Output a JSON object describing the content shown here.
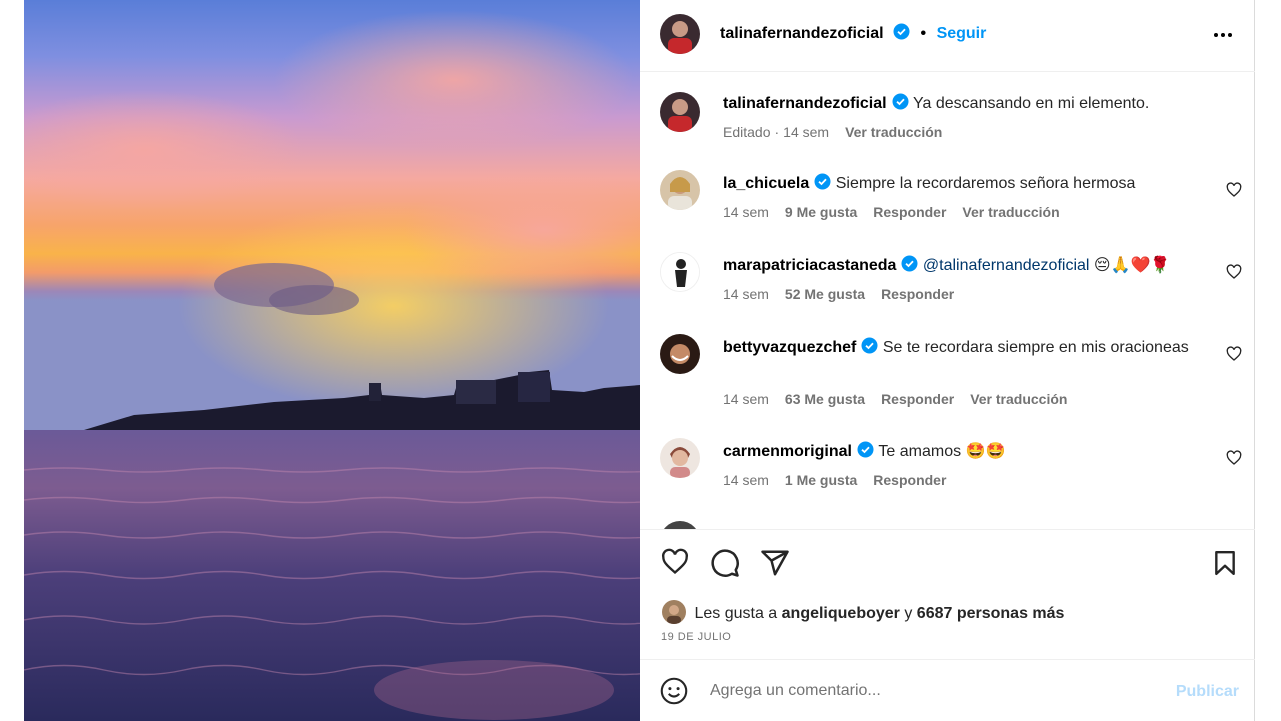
{
  "post": {
    "author": "talinafernandezoficial",
    "follow_label": "Seguir",
    "more_icon": "more-options-icon"
  },
  "caption": {
    "username": "talinafernandezoficial",
    "text": "Ya descansando en mi elemento.",
    "edited": "Editado",
    "time": "14 sem",
    "translate": "Ver traducción"
  },
  "comments": [
    {
      "username": "la_chicuela",
      "text": "Siempre la recordaremos señora hermosa",
      "time": "14 sem",
      "likes": "9 Me gusta",
      "reply": "Responder",
      "translate": "Ver traducción"
    },
    {
      "username": "marapatriciacastaneda",
      "mention": "@talinafernandezoficial",
      "emoji": "😔🙏❤️🌹",
      "time": "14 sem",
      "likes": "52 Me gusta",
      "reply": "Responder"
    },
    {
      "username": "bettyvazquezchef",
      "text": "Se te recordara siempre en mis oracioneas",
      "time": "14 sem",
      "likes": "63 Me gusta",
      "reply": "Responder",
      "translate": "Ver traducción"
    },
    {
      "username": "carmenmoriginal",
      "text": "Te amamos",
      "emoji": "🤩🤩",
      "time": "14 sem",
      "likes": "1 Me gusta",
      "reply": "Responder"
    }
  ],
  "likes": {
    "prefix": "Les gusta a",
    "user": "angeliqueboyer",
    "and": "y",
    "others": "6687 personas más"
  },
  "date": "19 DE JULIO",
  "add_comment": {
    "placeholder": "Agrega un comentario...",
    "publish": "Publicar"
  },
  "colors": {
    "accent": "#0095f6",
    "verified": "#0095f6",
    "muted": "#737373",
    "publish_disabled": "#b5dcfb"
  }
}
